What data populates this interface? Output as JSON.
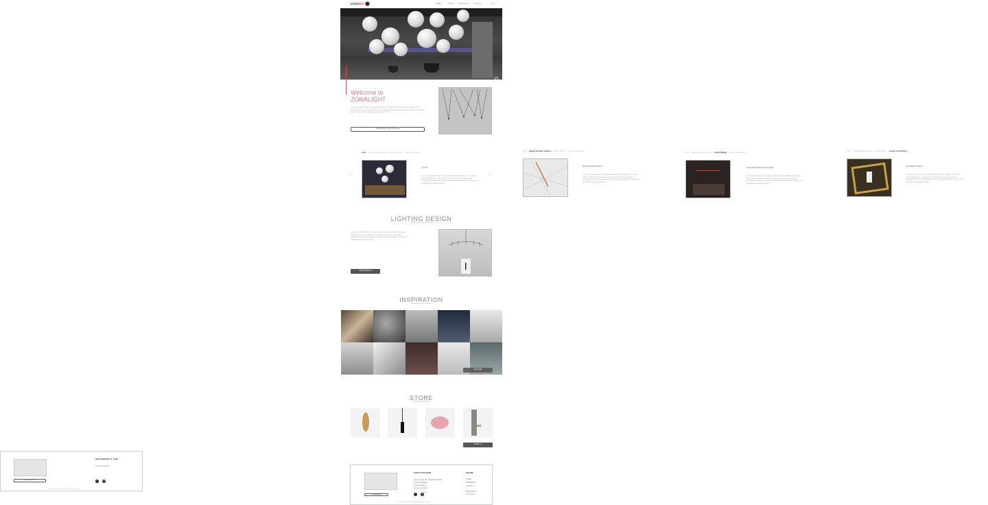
{
  "nav": {
    "logo_a": "zona",
    "logo_b": "light",
    "items": [
      "HOME",
      "STORE",
      "INSPIRATION",
      "CONTACT"
    ],
    "lang": "EN"
  },
  "welcome": {
    "title_line1": "Welcome to",
    "title_line2": "ZONALIGHT",
    "body": "Lorem ipsum dolor sit amet, consectetur adipiscing elit, sagittis dictum et vitae purus. Aenean eros, vestibulum sit amet, duis diam. Aenean enim, suspendisse hendrerit tellus egestas convallis proin aliquam sociis. In integer enim ut adipiscing orci dapibus tellus id.",
    "button": "ask quotation for your project"
  },
  "services": {
    "tabs": [
      "store",
      "lighting & design solutions",
      "project lighting",
      "custom constructions"
    ],
    "panels": [
      {
        "active": "store",
        "heading": "our store",
        "body": "Lorem ipsum dolor sit amet, consectetur adipiscing elit, sagittis vel et in nullam pretium. Aenean urna, maecenas ac dui in dolor, amet enim. Sed pretium suspendisse tincidunt tellus egestas convallis justo aliquam auctor. In integer enim ut adipiscing orci dapibus tellus id."
      },
      {
        "active": "lighting & design solutions",
        "heading": "lighting and design solutions",
        "body": "Lorem ipsum dolor sit amet, consectetur adipiscing elit, sagittis vel et in nullam pretium. Aenean urna, maecenas ac dui in dolor, amet enim. Sed pretium suspendisse tincidunt tellus egestas convallis justo aliquam auctor. In integer enim ut adipiscing orci dapibus tellus id."
      },
      {
        "active": "project lighting",
        "heading": "custom lighting solutions for your space",
        "body": "Lorem ipsum dolor sit amet, consectetur adipiscing elit, sagittis vel et in nullam pretium. Aenean urna, maecenas ac dui in dolor, amet enim. Sed pretium suspendisse tincidunt tellus egestas convallis justo aliquam auctor. In integer enim ut adipiscing orci dapibus tellus id."
      },
      {
        "active": "custom constructions",
        "heading": "custom lighting solutions",
        "body": "Lorem ipsum dolor sit amet, consectetur adipiscing elit, sagittis vel et in nullam pretium. Aenean urna, maecenas ac dui in dolor, amet enim. Sed pretium suspendisse tincidunt tellus egestas convallis justo aliquam auctor. In integer enim ut adipiscing orci dapibus tellus id."
      }
    ]
  },
  "lighting_design": {
    "title": "LIGHTING DESIGN",
    "subtitle": "custom solutions for your space",
    "body": "Lorem ipsum dolor sit amet, consectetur adipiscing elit, sagittis vel et in nullam pretium. Aenean urna, maecenas ac dui in dolor, amet enim. Sed pretium suspendisse tincidunt tellus egestas convallis justo aliquam auctor. In integer enim ut adipiscing orci dapibus tellus id.",
    "button": "LEARN MORE"
  },
  "inspiration": {
    "title": "INSPIRATION",
    "subtitle": "get inspired from our selection",
    "overlay_button": "SEE MORE"
  },
  "store": {
    "title": "STORE",
    "subtitle": "our best-selling products",
    "button": "STORE"
  },
  "footer_main": {
    "map_button": "open map route",
    "contact_heading": "CONTACT OUR STORE",
    "address": "Agiou Georgiou 14, Thessaloniki, 54300",
    "phone": "t: +30 2310 000000",
    "email": "info@zonalight.gr",
    "hours": "open mon-sat 10-21",
    "explore_heading": "EXPLORE",
    "explore_links": [
      "STORE",
      "INSPIRATION",
      "CONTACT"
    ],
    "explore_extra": [
      "lighting design",
      "terms of use"
    ],
    "copyright": "Copyright 2019 - Zonalight.gr - All Rights Reserved"
  },
  "footer_side": {
    "address": "AGIOU GEORGIOU 14 , 5 0000",
    "hours": "Open mon-sat 10-21",
    "map_button": "open map route",
    "copyright": "Copyright 2019 - Zonalight.gr - All Rights Reserved"
  },
  "colors": {
    "accent": "#d94a5a",
    "dark_button": "#555555"
  }
}
